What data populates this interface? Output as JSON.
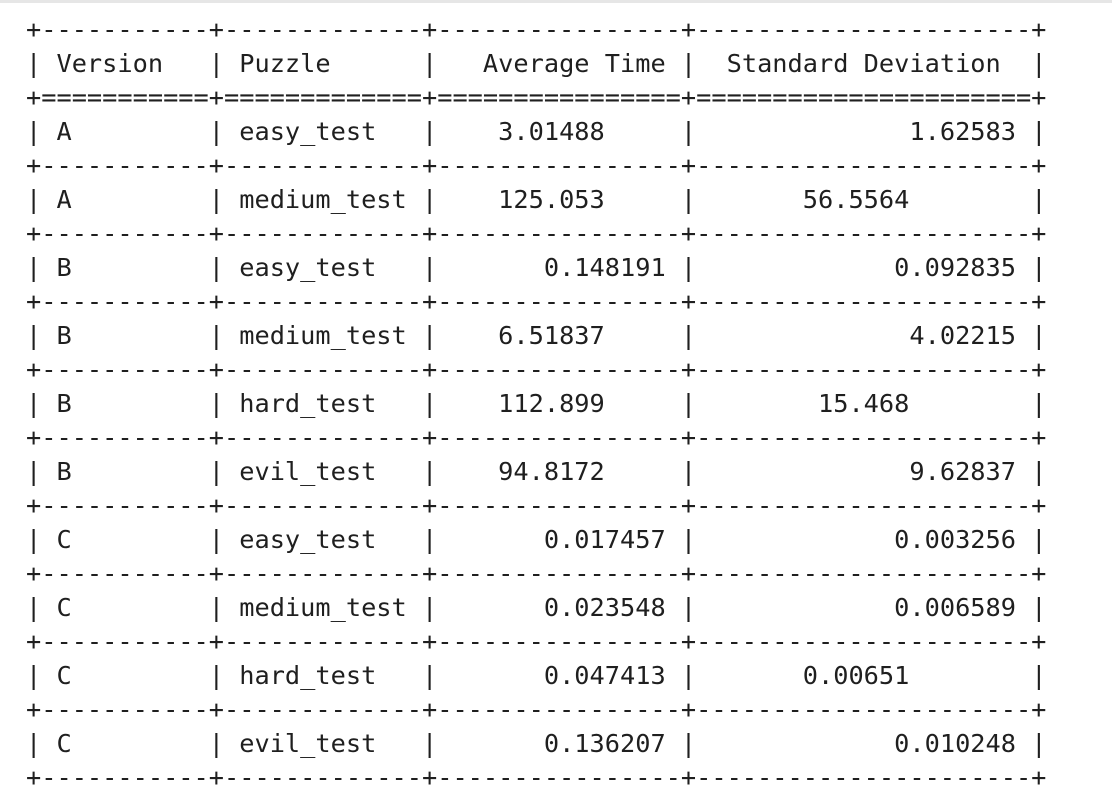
{
  "table": {
    "headers": [
      "Version",
      "Puzzle",
      "Average Time",
      "Standard Deviation"
    ],
    "header_align": [
      "left",
      "left",
      "right",
      "center"
    ],
    "col_align": [
      "left",
      "left",
      "right",
      "right"
    ],
    "col_widths": [
      11,
      13,
      16,
      22
    ],
    "rows": [
      {
        "cells": [
          "A",
          "easy_test",
          "3.01488",
          "1.62583"
        ],
        "align": [
          "left",
          "left",
          "center",
          "right"
        ]
      },
      {
        "cells": [
          "A",
          "medium_test",
          "125.053",
          "56.5564"
        ],
        "align": [
          "left",
          "left",
          "center",
          "center"
        ]
      },
      {
        "cells": [
          "B",
          "easy_test",
          "0.148191",
          "0.092835"
        ],
        "align": [
          "left",
          "left",
          "right",
          "right"
        ]
      },
      {
        "cells": [
          "B",
          "medium_test",
          "6.51837",
          "4.02215"
        ],
        "align": [
          "left",
          "left",
          "center",
          "right"
        ]
      },
      {
        "cells": [
          "B",
          "hard_test",
          "112.899",
          "15.468"
        ],
        "align": [
          "left",
          "left",
          "center",
          "center"
        ]
      },
      {
        "cells": [
          "B",
          "evil_test",
          "94.8172",
          "9.62837"
        ],
        "align": [
          "left",
          "left",
          "center",
          "right"
        ]
      },
      {
        "cells": [
          "C",
          "easy_test",
          "0.017457",
          "0.003256"
        ],
        "align": [
          "left",
          "left",
          "right",
          "right"
        ]
      },
      {
        "cells": [
          "C",
          "medium_test",
          "0.023548",
          "0.006589"
        ],
        "align": [
          "left",
          "left",
          "right",
          "right"
        ]
      },
      {
        "cells": [
          "C",
          "hard_test",
          "0.047413",
          "0.00651"
        ],
        "align": [
          "left",
          "left",
          "right",
          "center"
        ]
      },
      {
        "cells": [
          "C",
          "evil_test",
          "0.136207",
          "0.010248"
        ],
        "align": [
          "left",
          "left",
          "right",
          "right"
        ]
      }
    ]
  }
}
